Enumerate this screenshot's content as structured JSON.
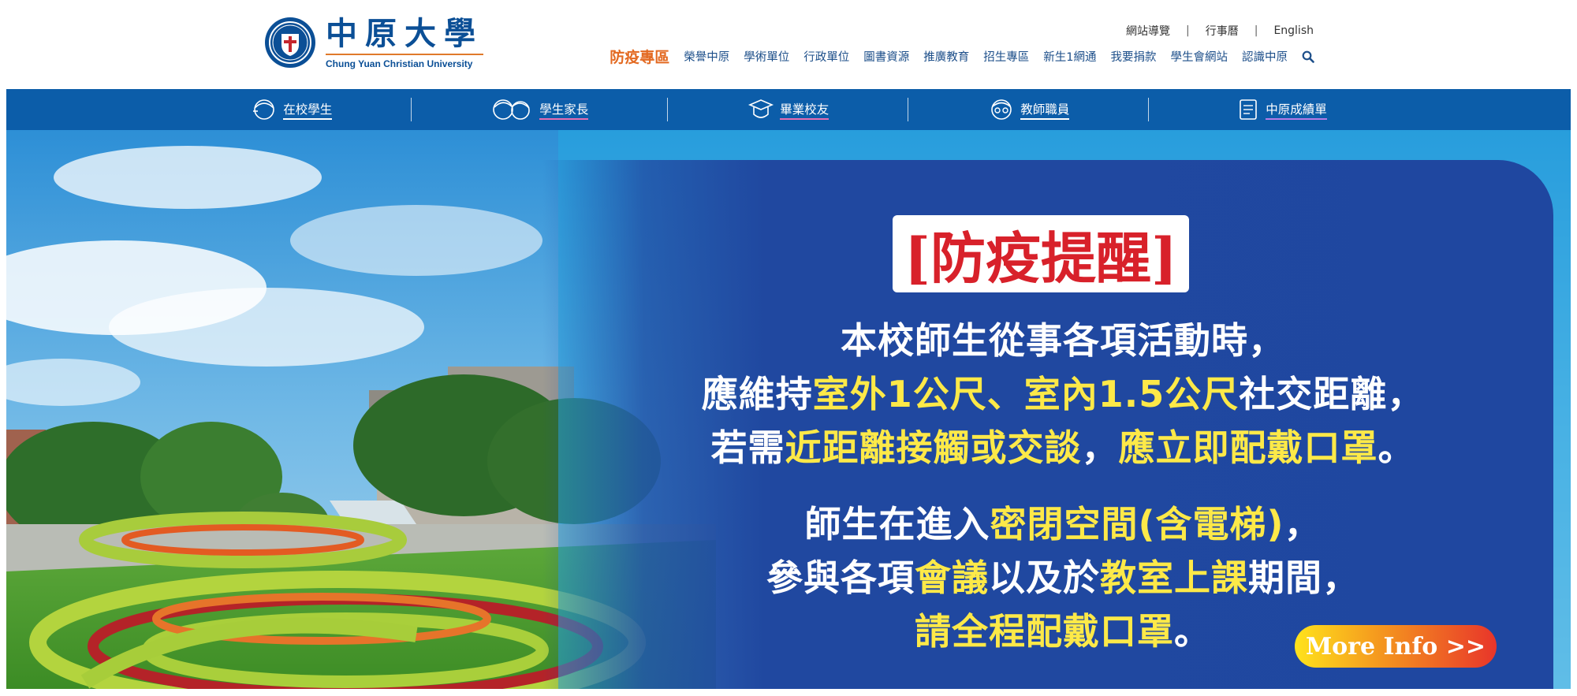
{
  "header": {
    "logo_cn": "中原大學",
    "logo_en": "Chung Yuan Christian University",
    "top_links": [
      "網站導覽",
      "行事曆",
      "English"
    ],
    "nav": {
      "highlight": "防疫專區",
      "items": [
        "榮譽中原",
        "學術單位",
        "行政單位",
        "圖書資源",
        "推廣教育",
        "招生專區",
        "新生1網通",
        "我要捐款",
        "學生會網站",
        "認識中原"
      ]
    }
  },
  "subnav": {
    "items": [
      {
        "label": "在校學生",
        "icon": "student-icon"
      },
      {
        "label": "學生家長",
        "icon": "parents-icon"
      },
      {
        "label": "畢業校友",
        "icon": "graduate-cap-icon"
      },
      {
        "label": "教師職員",
        "icon": "teacher-icon"
      },
      {
        "label": "中原成績單",
        "icon": "scroll-icon"
      }
    ]
  },
  "banner": {
    "title": "[防疫提醒]",
    "line1": "本校師生從事各項活動時，",
    "line2": {
      "a": "應維持",
      "b": "室外1公尺、室內1.5公尺",
      "c": "社交距離，"
    },
    "line3": {
      "a": "若需",
      "b": "近距離接觸或交談",
      "c": "，",
      "d": "應立即配戴口罩",
      "e": "。"
    },
    "line4": {
      "a": "師生在進入",
      "b": "密閉空間(含電梯)",
      "c": "，"
    },
    "line5": {
      "a": "參與各項",
      "b": "會議",
      "c": "以及於",
      "d": "教室上課",
      "e": "期間，"
    },
    "line6": {
      "a": "請全程配戴口罩",
      "b": "。"
    },
    "more_button": "More Info >>"
  },
  "colors": {
    "brand_blue": "#0b4f96",
    "nav_bar": "#0c5da9",
    "highlight_orange": "#e36a22",
    "alert_red": "#d8212a",
    "emphasis_yellow": "#fde948"
  }
}
